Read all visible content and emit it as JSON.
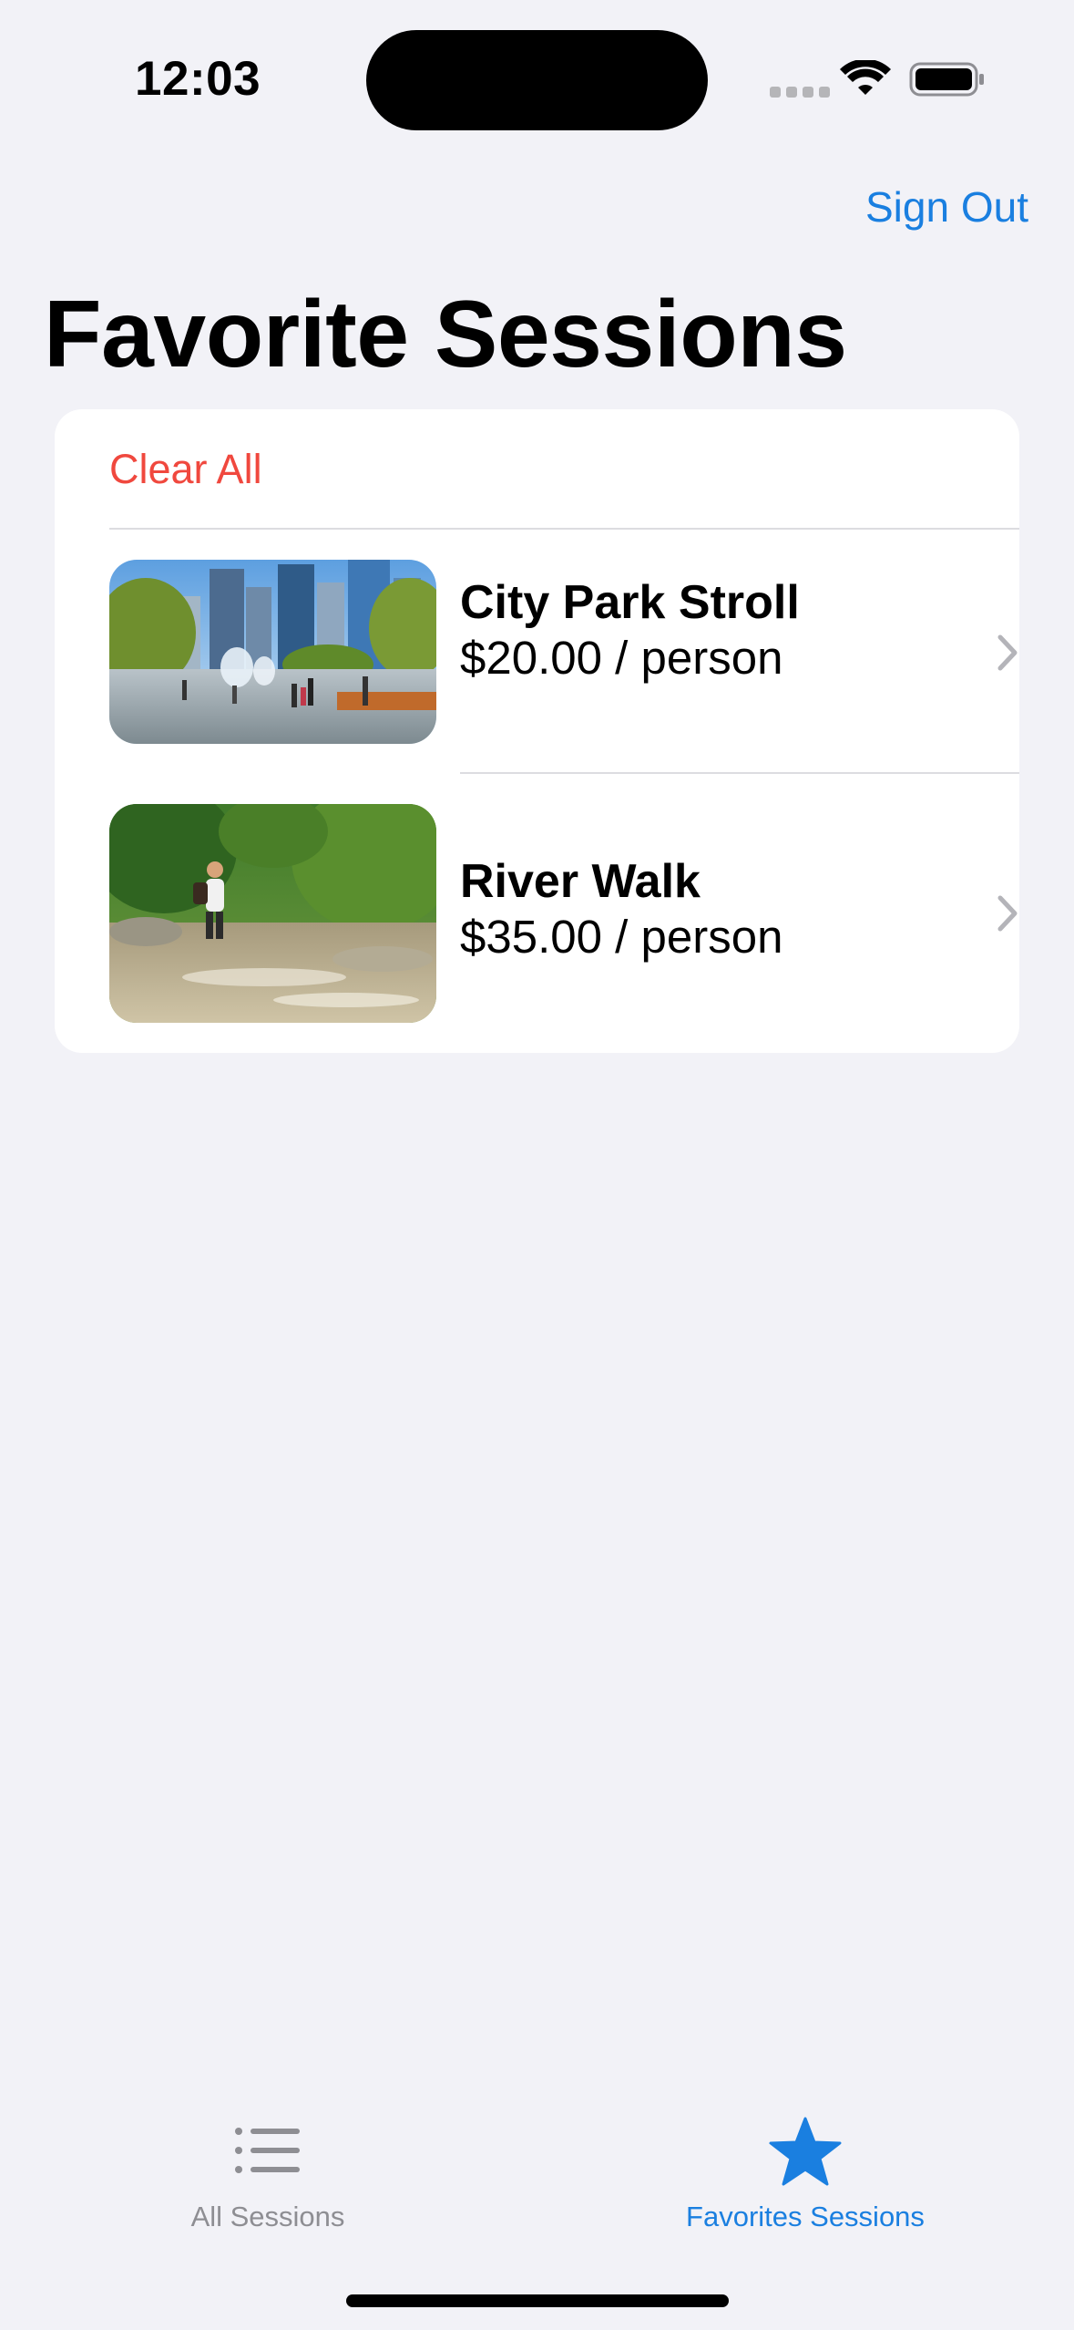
{
  "status_bar": {
    "time": "12:03"
  },
  "nav": {
    "sign_out_label": "Sign Out"
  },
  "page": {
    "title": "Favorite Sessions"
  },
  "list": {
    "clear_all_label": "Clear All",
    "items": [
      {
        "title": "City Park Stroll",
        "price": "$20.00 / person",
        "image": "city-park-photo"
      },
      {
        "title": "River Walk",
        "price": "$35.00 / person",
        "image": "river-walk-photo"
      }
    ]
  },
  "tab_bar": {
    "tabs": [
      {
        "label": "All Sessions",
        "icon": "list-icon",
        "selected": false
      },
      {
        "label": "Favorites Sessions",
        "icon": "star-icon",
        "selected": true
      }
    ]
  },
  "colors": {
    "accent": "#1a7fe0",
    "destructive": "#f0483e",
    "background": "#f2f2f7",
    "inactive_tab": "#8e8e93"
  }
}
